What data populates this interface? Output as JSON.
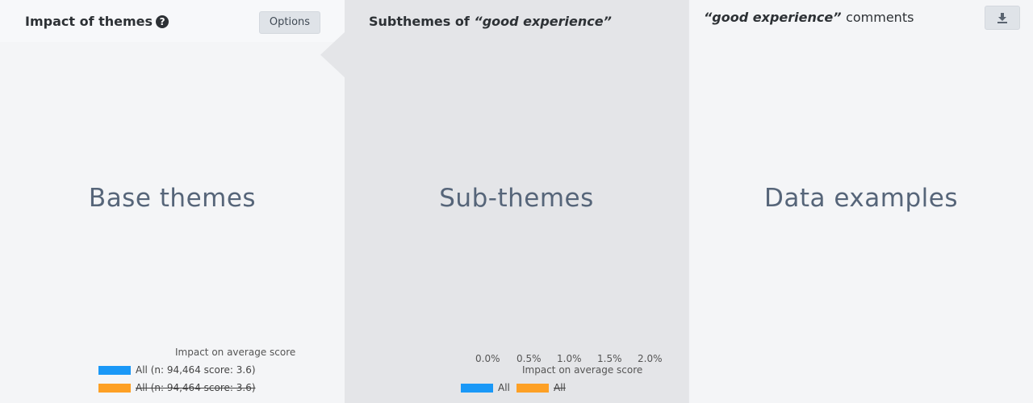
{
  "left": {
    "title": "Impact of themes",
    "help_icon": "question-circle-icon",
    "options_label": "Options",
    "placeholder": "Base themes",
    "chart": {
      "axis_title": "Impact on average score",
      "legend": [
        {
          "label": "All (n: 94,464 score: 3.6)",
          "color": "#1a98f7",
          "enabled": true
        },
        {
          "label": "All (n: 94,464 score: 3.6)",
          "color": "#fda025",
          "enabled": false
        }
      ]
    }
  },
  "middle": {
    "title_prefix": "Subthemes of",
    "title_theme": "“good experience”",
    "placeholder": "Sub-themes",
    "chart": {
      "ticks": [
        "0.0%",
        "0.5%",
        "1.0%",
        "1.5%",
        "2.0%"
      ],
      "axis_title": "Impact on average score",
      "legend": [
        {
          "label": "All",
          "color": "#1a98f7",
          "enabled": true
        },
        {
          "label": "All",
          "color": "#fda025",
          "enabled": false
        }
      ]
    }
  },
  "right": {
    "title_theme": "“good experience”",
    "title_suffix": "comments",
    "download_icon": "download-icon",
    "placeholder": "Data examples"
  }
}
